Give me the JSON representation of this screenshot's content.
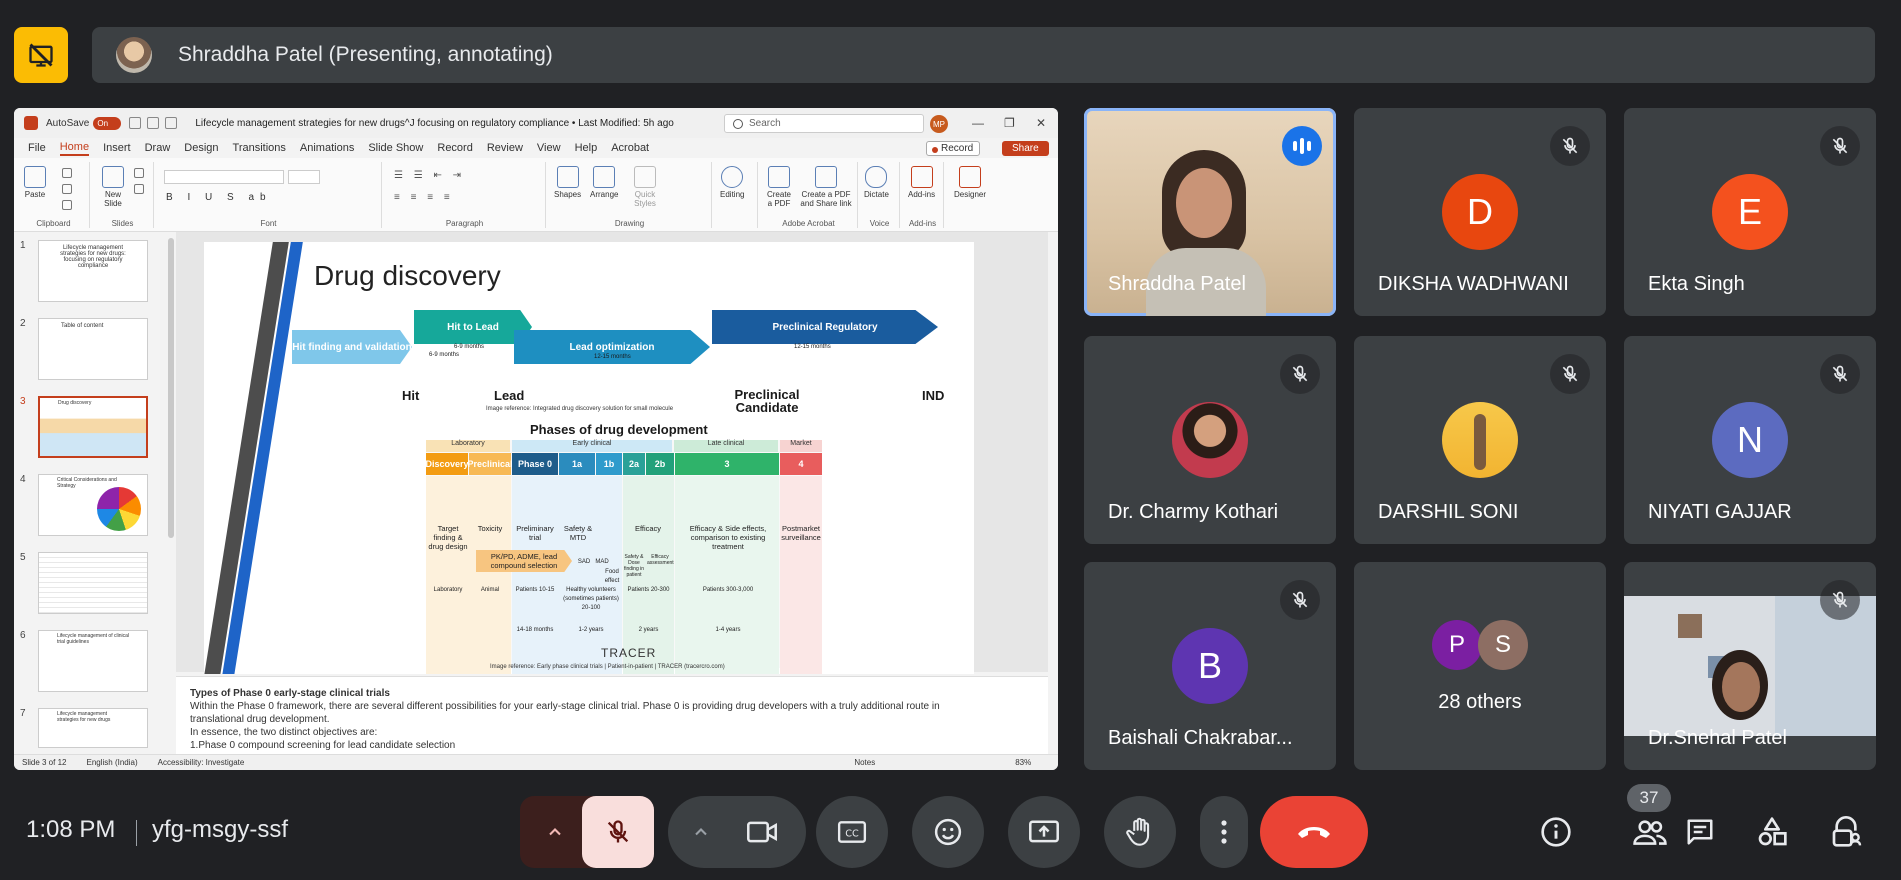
{
  "meeting": {
    "presenter_text": "Shraddha Patel (Presenting, annotating)",
    "time": "1:08 PM",
    "code": "yfg-msgy-ssf",
    "participant_count": "37"
  },
  "ppt": {
    "autosave_label": "AutoSave",
    "autosave_state": "On",
    "doc_title": "Lifecycle management strategies for new drugs^J focusing on regulatory compliance • Last Modified: 5h ago",
    "search_placeholder": "Search",
    "user_initials": "MP",
    "menu": [
      "File",
      "Home",
      "Insert",
      "Draw",
      "Design",
      "Transitions",
      "Animations",
      "Slide Show",
      "Record",
      "Review",
      "View",
      "Help",
      "Acrobat"
    ],
    "record_label": "Record",
    "share_label": "Share",
    "ribbon_groups": [
      "Clipboard",
      "Slides",
      "Font",
      "Paragraph",
      "Drawing",
      "Adobe Acrobat",
      "Voice",
      "Add-ins"
    ],
    "ribbon_buttons": {
      "paste": "Paste",
      "new_slide": "New Slide",
      "shapes": "Shapes",
      "arrange": "Arrange",
      "quick_styles": "Quick Styles",
      "editing": "Editing",
      "create_pdf": "Create a PDF",
      "create_pdf_share": "Create a PDF and Share link",
      "dictate": "Dictate",
      "addins": "Add-ins",
      "designer": "Designer"
    },
    "thumbnails": [
      {
        "num": "1",
        "text": "Lifecycle management strategies for new drugs: focusing on regulatory compliance"
      },
      {
        "num": "2",
        "text": "Table of content"
      },
      {
        "num": "3",
        "text": "Drug discovery"
      },
      {
        "num": "4",
        "text": "Critical Considerations and Strategy"
      },
      {
        "num": "5",
        "text": ""
      },
      {
        "num": "6",
        "text": "Lifecycle management of clinical trial guidelines"
      },
      {
        "num": "7",
        "text": "Lifecycle management strategies for new drugs"
      }
    ],
    "slide": {
      "title": "Drug discovery",
      "stages": [
        {
          "label": "Hit finding and validation",
          "duration": "6-9 months"
        },
        {
          "label": "Hit to Lead",
          "duration": "6-9 months"
        },
        {
          "label": "Lead optimization",
          "duration": "12-15 months"
        },
        {
          "label": "Preclinical Regulatory",
          "duration": "12-15 months"
        }
      ],
      "milestones": [
        "Hit",
        "Lead",
        "Preclinical Candidate",
        "IND"
      ],
      "image_ref_1": "Image reference: Integrated drug discovery solution for small molecule",
      "phases_title": "Phases of drug development",
      "categories": [
        "Laboratory",
        "Early clinical",
        "Late clinical",
        "Market"
      ],
      "phase_headers": [
        "Discovery",
        "Preclinical",
        "Phase 0",
        "1a",
        "1b",
        "2a",
        "2b",
        "3",
        "4"
      ],
      "phase_desc": [
        "Target finding & drug design",
        "Toxicity",
        "Preliminary trial",
        "Safety & MTD",
        "Efficacy",
        "Efficacy & Side effects, comparison to existing treatment",
        "Postmarket surveillance"
      ],
      "pkpd_label": "PK/PD, ADME, lead compound selection",
      "sub_labels": [
        "SAD",
        "MAD",
        "Food effect",
        "Safety & Dose finding in patient",
        "Efficacy assessment"
      ],
      "setting_row": [
        "Laboratory",
        "Animal",
        "Patients 10-15",
        "Healthy volunteers (sometimes patients) 20-100",
        "Patients 20-300",
        "Patients 300-3,000"
      ],
      "duration_row": [
        "14-18 months",
        "1-2 years",
        "2 years",
        "1-4 years"
      ],
      "tracer": "TRACER",
      "image_ref_2": "Image reference: Early phase clinical trials | Patient-in-patient | TRACER (tracercro.com)"
    },
    "notes_title": "Types of Phase 0 early-stage clinical trials",
    "notes_lines": [
      "Within the Phase 0 framework, there are several different possibilities for your early-stage clinical trial. Phase 0 is providing drug developers with a truly additional route in",
      "translational drug development.",
      "In essence, the two distinct objectives are:",
      "1.Phase 0 compound screening for lead candidate selection"
    ],
    "status": {
      "slide": "Slide 3 of 12",
      "lang": "English (India)",
      "access": "Accessibility: Investigate",
      "notes": "Notes",
      "zoom": "83%"
    }
  },
  "participants": [
    {
      "name": "Shraddha Patel",
      "type": "video",
      "speaking": true
    },
    {
      "name": "DIKSHA WADHWANI",
      "type": "letter",
      "letter": "D",
      "color": "#e8470f",
      "muted": true
    },
    {
      "name": "Ekta Singh",
      "type": "letter",
      "letter": "E",
      "color": "#f4511e",
      "muted": true
    },
    {
      "name": "Dr. Charmy Kothari",
      "type": "photo",
      "muted": true
    },
    {
      "name": "DARSHIL SONI",
      "type": "photo",
      "muted": true
    },
    {
      "name": "NIYATI GAJJAR",
      "type": "letter",
      "letter": "N",
      "color": "#5c6bc0",
      "muted": true
    },
    {
      "name": "Baishali Chakrabar...",
      "type": "letter",
      "letter": "B",
      "color": "#5e35b1",
      "muted": true
    },
    {
      "name": "28 others",
      "type": "group",
      "letters": [
        "P",
        "S"
      ],
      "colors": [
        "#7b1fa2",
        "#8d6e63"
      ]
    },
    {
      "name": "Dr.Snehal Patel",
      "type": "video",
      "muted": true
    }
  ],
  "colors": {
    "background": "#202124",
    "tile": "#3c4043",
    "end_call": "#ea4335",
    "mic_off": "#f9dedc",
    "presenter_logo": "#fbbc04",
    "accent_blue": "#8ab4f8"
  }
}
